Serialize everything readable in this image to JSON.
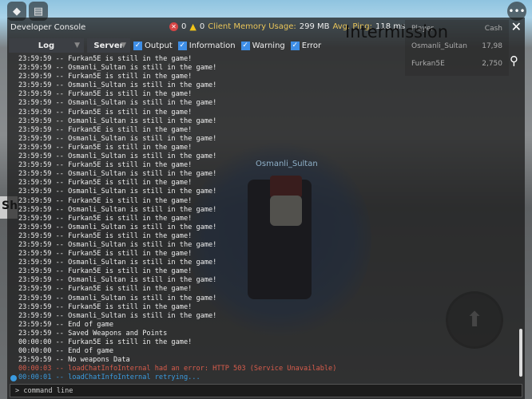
{
  "game": {
    "intermission": "Intermission",
    "nametag": "Osmanli_Sultan",
    "side_button": "Sh",
    "leaderboard": {
      "header_left": "Player",
      "header_right": "Cash",
      "rows": [
        {
          "name": "Osmanli_Sultan",
          "value": "17,98"
        },
        {
          "name": "Furkan5E",
          "value": "2,750"
        }
      ]
    }
  },
  "console": {
    "title": "Developer Console",
    "errors": "0",
    "warnings": "0",
    "memory_label": "Client Memory Usage:",
    "memory_value": "299 MB",
    "ping_label": "Avg. Ping:",
    "ping_value": "118 ms",
    "log_dropdown": "Log",
    "server_dropdown": "Server",
    "filters": [
      {
        "label": "Output",
        "checked": true
      },
      {
        "label": "Information",
        "checked": true
      },
      {
        "label": "Warning",
        "checked": true
      },
      {
        "label": "Error",
        "checked": true
      }
    ],
    "command_placeholder": "> command line",
    "lines": [
      {
        "t": "23:59:59 -- Furkan5E is still in the game!",
        "k": "n"
      },
      {
        "t": "23:59:59 -- Osmanli_Sultan is still in the game!",
        "k": "n"
      },
      {
        "t": "23:59:59 -- Furkan5E is still in the game!",
        "k": "n"
      },
      {
        "t": "23:59:59 -- Osmanli_Sultan is still in the game!",
        "k": "n"
      },
      {
        "t": "23:59:59 -- Furkan5E is still in the game!",
        "k": "n"
      },
      {
        "t": "23:59:59 -- Osmanli_Sultan is still in the game!",
        "k": "n"
      },
      {
        "t": "23:59:59 -- Furkan5E is still in the game!",
        "k": "n"
      },
      {
        "t": "23:59:59 -- Osmanli_Sultan is still in the game!",
        "k": "n"
      },
      {
        "t": "23:59:59 -- Furkan5E is still in the game!",
        "k": "n"
      },
      {
        "t": "23:59:59 -- Osmanli_Sultan is still in the game!",
        "k": "n"
      },
      {
        "t": "23:59:59 -- Furkan5E is still in the game!",
        "k": "n"
      },
      {
        "t": "23:59:59 -- Osmanli_Sultan is still in the game!",
        "k": "n"
      },
      {
        "t": "23:59:59 -- Furkan5E is still in the game!",
        "k": "n"
      },
      {
        "t": "23:59:59 -- Osmanli_Sultan is still in the game!",
        "k": "n"
      },
      {
        "t": "23:59:59 -- Furkan5E is still in the game!",
        "k": "n"
      },
      {
        "t": "23:59:59 -- Osmanli_Sultan is still in the game!",
        "k": "n"
      },
      {
        "t": "23:59:59 -- Furkan5E is still in the game!",
        "k": "n"
      },
      {
        "t": "23:59:59 -- Osmanli_Sultan is still in the game!",
        "k": "n"
      },
      {
        "t": "23:59:59 -- Furkan5E is still in the game!",
        "k": "n"
      },
      {
        "t": "23:59:59 -- Osmanli_Sultan is still in the game!",
        "k": "n"
      },
      {
        "t": "23:59:59 -- Furkan5E is still in the game!",
        "k": "n"
      },
      {
        "t": "23:59:59 -- Osmanli_Sultan is still in the game!",
        "k": "n"
      },
      {
        "t": "23:59:59 -- Furkan5E is still in the game!",
        "k": "n"
      },
      {
        "t": "23:59:59 -- Osmanli_Sultan is still in the game!",
        "k": "n"
      },
      {
        "t": "23:59:59 -- Furkan5E is still in the game!",
        "k": "n"
      },
      {
        "t": "23:59:59 -- Osmanli_Sultan is still in the game!",
        "k": "n"
      },
      {
        "t": "23:59:59 -- Furkan5E is still in the game!",
        "k": "n"
      },
      {
        "t": "23:59:59 -- Osmanli_Sultan is still in the game!",
        "k": "n"
      },
      {
        "t": "23:59:59 -- Furkan5E is still in the game!",
        "k": "n"
      },
      {
        "t": "23:59:59 -- Osmanli_Sultan is still in the game!",
        "k": "n"
      },
      {
        "t": "23:59:59 -- End of game",
        "k": "n"
      },
      {
        "t": "23:59:59 -- Saved Weapons and Points",
        "k": "n"
      },
      {
        "t": "00:00:00 -- Furkan5E is still in the game!",
        "k": "n"
      },
      {
        "t": "00:00:00 -- End of game",
        "k": "n"
      },
      {
        "t": "23:59:59 -- No weapons Data",
        "k": "n"
      },
      {
        "t": "00:00:03 -- loadChatInfoInternal had an error: HTTP 503 (Service Unavailable)",
        "k": "e"
      },
      {
        "t": "00:00:01 -- loadChatInfoInternal retrying...",
        "k": "i"
      }
    ]
  }
}
